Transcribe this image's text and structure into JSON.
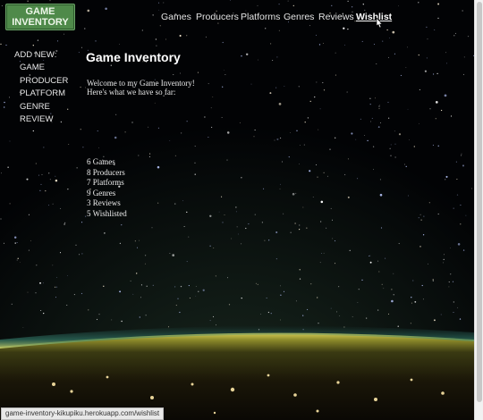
{
  "logo": {
    "line1": "GAME",
    "line2": "INVENTORY"
  },
  "nav": [
    {
      "label": "Games",
      "active": false
    },
    {
      "label": "Producers",
      "active": false
    },
    {
      "label": "Platforms",
      "active": false
    },
    {
      "label": "Genres",
      "active": false
    },
    {
      "label": "Reviews",
      "active": false
    },
    {
      "label": "Wishlist",
      "active": true
    }
  ],
  "sidebar": {
    "heading": "ADD NEW:",
    "items": [
      "GAME",
      "PRODUCER",
      "PLATFORM",
      "GENRE",
      "REVIEW"
    ]
  },
  "main": {
    "title": "Game Inventory",
    "welcome_line1": "Welcome to my Game Inventory!",
    "welcome_line2": "Here's what we have so far:",
    "stats": [
      "6 Games",
      "8 Producers",
      "7 Platforms",
      "9 Genres",
      "3 Reviews",
      "5 Wishlisted"
    ]
  },
  "status_url": "game-inventory-kikupiku.herokuapp.com/wishlist",
  "colors": {
    "logo_bg": "#4f8a4a",
    "text": "#e6e6e6",
    "background": "#020305",
    "earth_glow": "#d8c64a"
  }
}
